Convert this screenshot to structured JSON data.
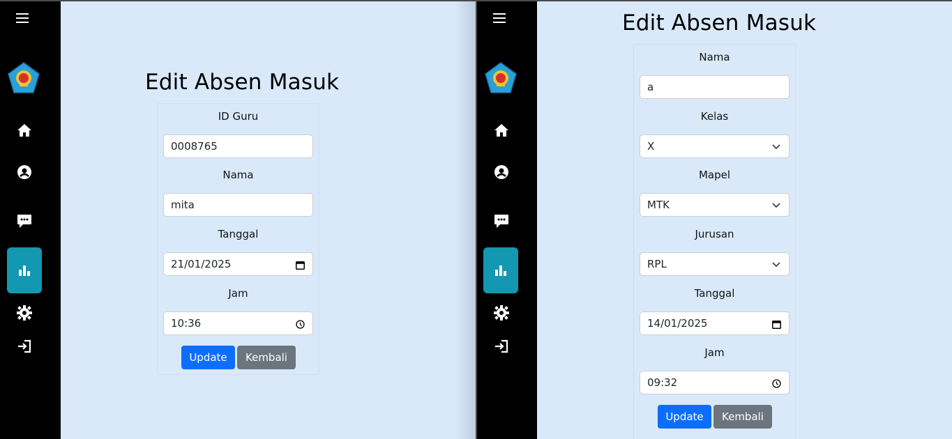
{
  "left": {
    "title": "Edit Absen Masuk",
    "fields": [
      {
        "label": "ID Guru",
        "value": "0008765",
        "type": "text"
      },
      {
        "label": "Nama",
        "value": "mita",
        "type": "text"
      },
      {
        "label": "Tanggal",
        "value": "21/01/2025",
        "type": "date"
      },
      {
        "label": "Jam",
        "value": "10:36",
        "type": "time"
      }
    ],
    "update_label": "Update",
    "back_label": "Kembali"
  },
  "right": {
    "title": "Edit Absen Masuk",
    "fields": [
      {
        "label": "Nama",
        "value": "a",
        "type": "text"
      },
      {
        "label": "Kelas",
        "value": "X",
        "type": "select"
      },
      {
        "label": "Mapel",
        "value": "MTK",
        "type": "select"
      },
      {
        "label": "Jurusan",
        "value": "RPL",
        "type": "select"
      },
      {
        "label": "Tanggal",
        "value": "14/01/2025",
        "type": "date"
      },
      {
        "label": "Jam",
        "value": "09:32",
        "type": "time"
      }
    ],
    "update_label": "Update",
    "back_label": "Kembali"
  },
  "sidebar": {
    "icons": [
      "menu-icon",
      "school-logo",
      "home-icon",
      "user-circle-icon",
      "chat-icon",
      "bar-chart-icon",
      "gear-icon",
      "sign-in-icon"
    ],
    "active_item": "bar-chart-icon"
  },
  "colors": {
    "background": "#d9e9fa",
    "sidebar": "#000000",
    "active_nav": "#1497b0",
    "primary": "#0d6efd",
    "secondary": "#6c757d"
  }
}
